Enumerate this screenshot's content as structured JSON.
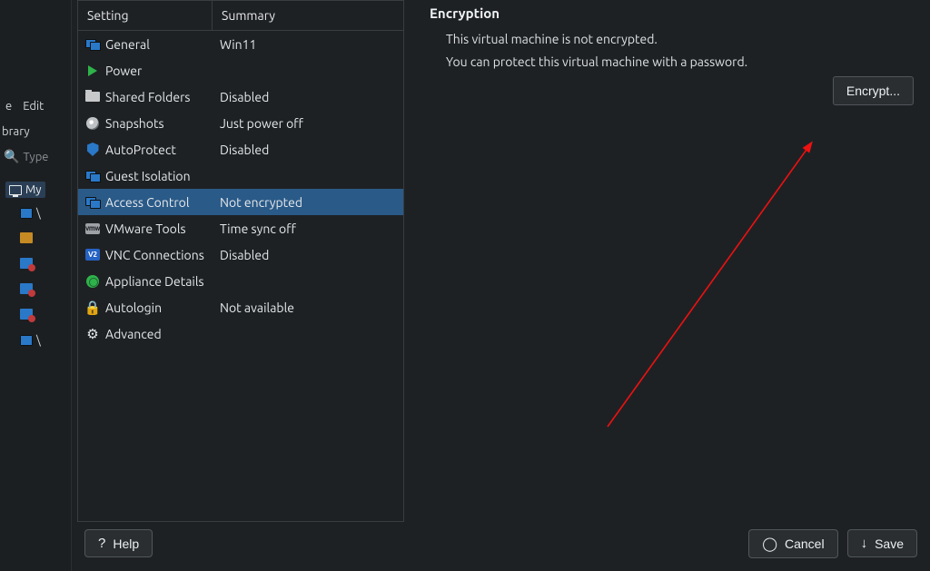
{
  "background": {
    "menu": {
      "file_fragment": "e",
      "edit": "Edit"
    },
    "library_label": "brary",
    "search_placeholder": "Type",
    "my_computer": "My",
    "right_check": "✓"
  },
  "columns": {
    "setting": "Setting",
    "summary": "Summary"
  },
  "settings": [
    {
      "key": "general",
      "label": "General",
      "summary": "Win11"
    },
    {
      "key": "power",
      "label": "Power",
      "summary": ""
    },
    {
      "key": "shared-folders",
      "label": "Shared Folders",
      "summary": "Disabled"
    },
    {
      "key": "snapshots",
      "label": "Snapshots",
      "summary": "Just power off"
    },
    {
      "key": "autoprotect",
      "label": "AutoProtect",
      "summary": "Disabled"
    },
    {
      "key": "guest-isolation",
      "label": "Guest Isolation",
      "summary": ""
    },
    {
      "key": "access-control",
      "label": "Access Control",
      "summary": "Not encrypted"
    },
    {
      "key": "vmware-tools",
      "label": "VMware Tools",
      "summary": "Time sync off"
    },
    {
      "key": "vnc-connections",
      "label": "VNC Connections",
      "summary": "Disabled"
    },
    {
      "key": "appliance",
      "label": "Appliance Details",
      "summary": ""
    },
    {
      "key": "autologin",
      "label": "Autologin",
      "summary": "Not available"
    },
    {
      "key": "advanced",
      "label": "Advanced",
      "summary": ""
    }
  ],
  "selected_setting_key": "access-control",
  "detail": {
    "heading": "Encryption",
    "line1": "This virtual machine is not encrypted.",
    "line2": "You can protect this virtual machine with a password.",
    "encrypt_button": "Encrypt..."
  },
  "buttons": {
    "help": "Help",
    "cancel": "Cancel",
    "save": "Save"
  },
  "icons": {
    "help": "?",
    "cancel": "◯",
    "save_arrow": "↓",
    "vmw_text": "vmw",
    "vnc_text": "V2"
  }
}
